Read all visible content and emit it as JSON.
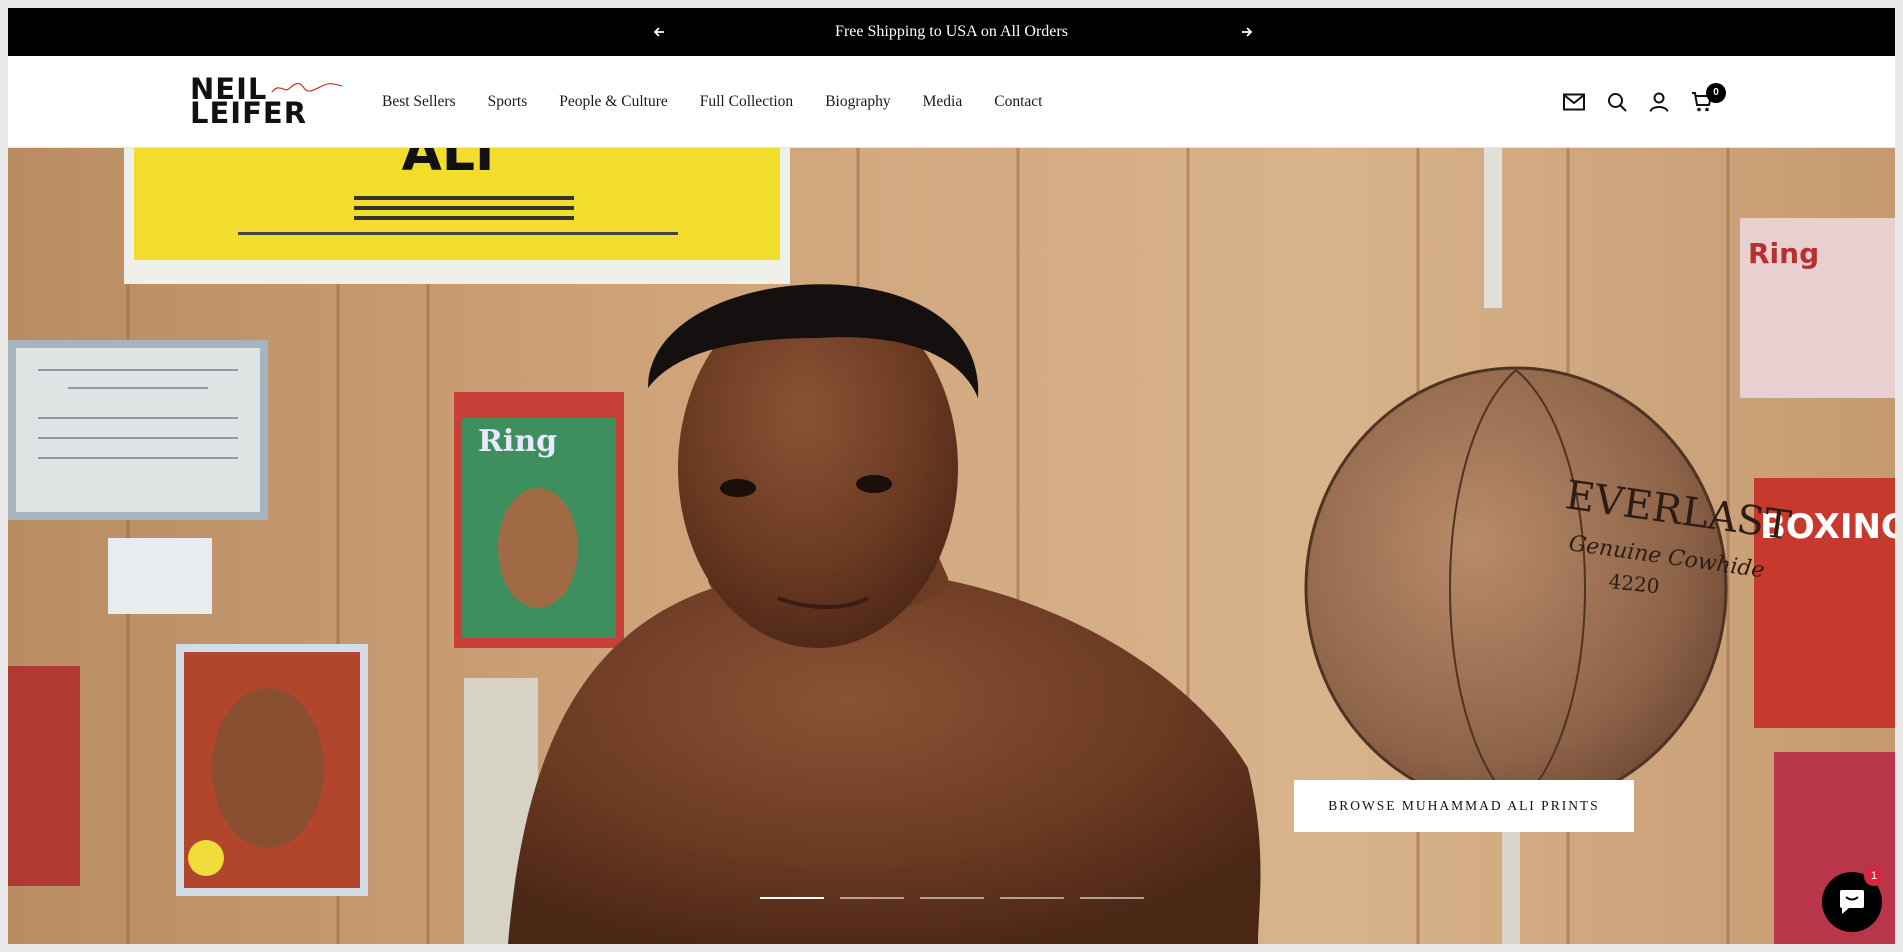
{
  "announcement": {
    "message": "Free Shipping to USA on All Orders",
    "prev_icon": "arrow-left-icon",
    "next_icon": "arrow-right-icon"
  },
  "header": {
    "logo": {
      "line1": "NEIL",
      "line2": "LEIFER"
    },
    "nav": [
      {
        "label": "Best Sellers"
      },
      {
        "label": "Sports"
      },
      {
        "label": "People & Culture"
      },
      {
        "label": "Full Collection"
      },
      {
        "label": "Biography"
      },
      {
        "label": "Media"
      },
      {
        "label": "Contact"
      }
    ],
    "icons": [
      "mail-icon",
      "search-icon",
      "account-icon",
      "cart-icon"
    ],
    "cart_count": "0"
  },
  "hero": {
    "cta_label": "BROWSE MUHAMMAD ALI PRINTS",
    "slide_count": 5,
    "active_slide": 1,
    "poster_text": "ALI",
    "magazine_ring": "Ring",
    "magazine_boxing": "BOXING",
    "bag_brand": "EVERLAST",
    "bag_sub": "Genuine Cowhide",
    "bag_number": "4220"
  },
  "chat": {
    "icon": "chat-icon",
    "badge": "1"
  },
  "colors": {
    "announcement_bg": "#000000",
    "badge_red": "#d7263d",
    "wood": "#c79a6c"
  }
}
